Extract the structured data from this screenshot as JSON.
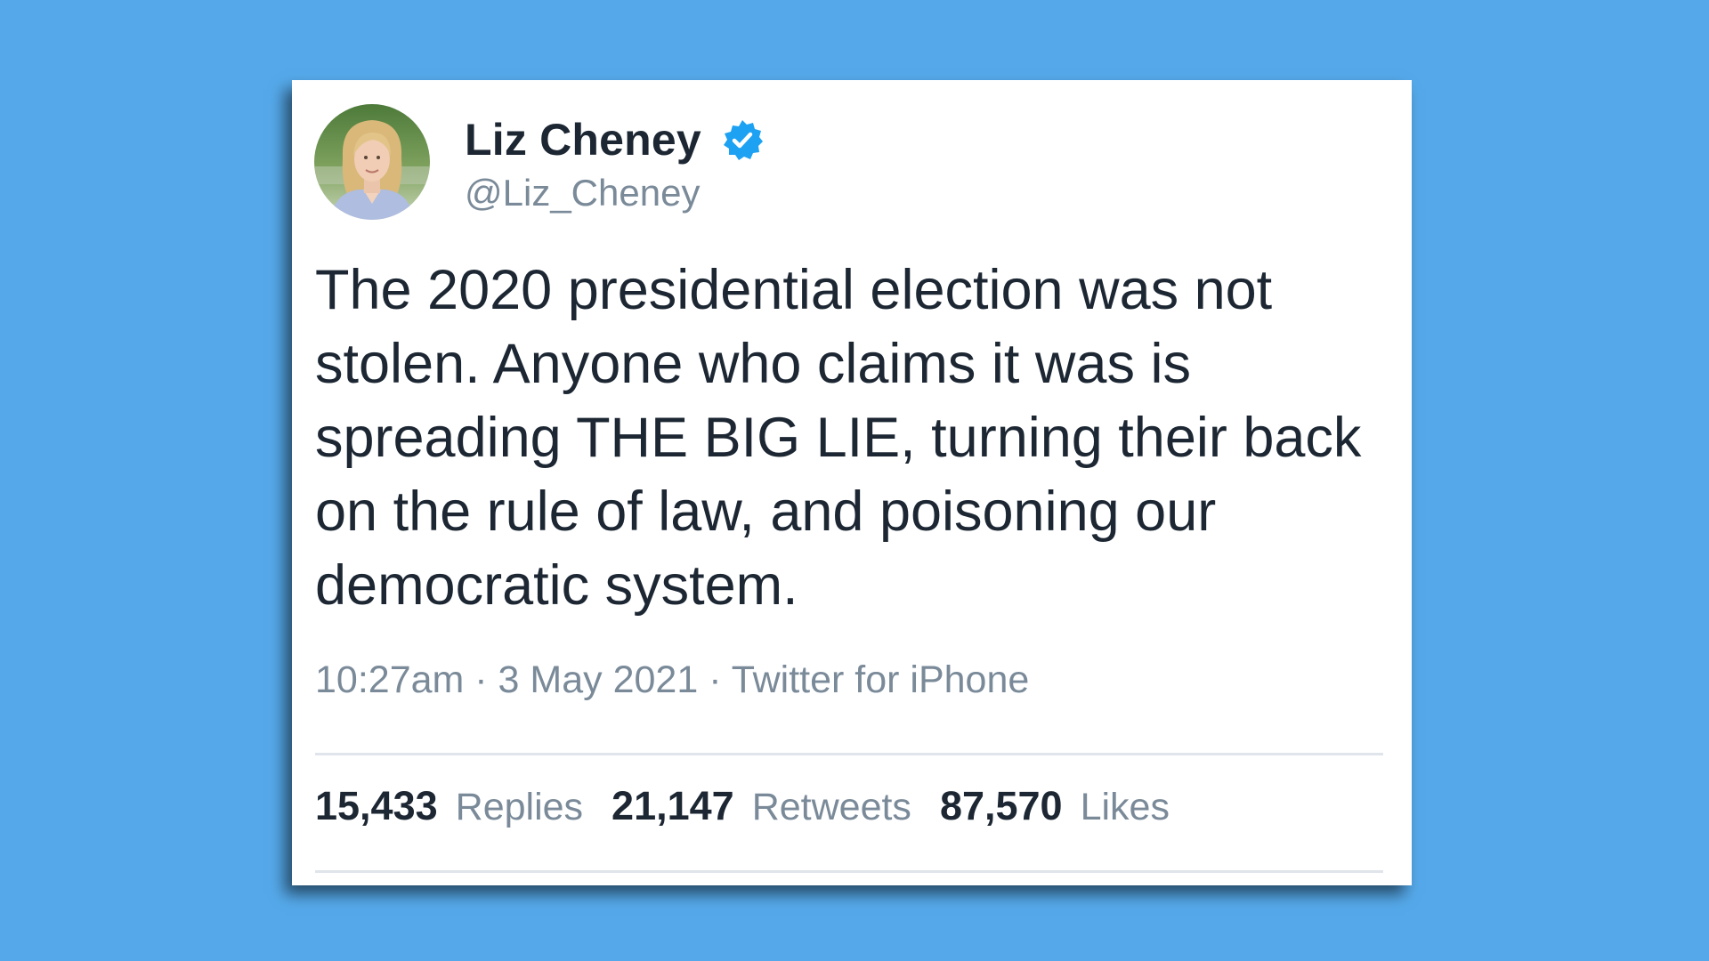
{
  "background_color": "#55a9ea",
  "accent_color": "#1da1f2",
  "tweet": {
    "author": {
      "name": "Liz Cheney",
      "handle": "@Liz_Cheney",
      "verified_icon": "verified-badge-icon",
      "avatar_icon": "profile-photo"
    },
    "text": "The 2020 presidential election was not stolen. Anyone who claims it was is spreading THE BIG LIE, turning their back on the rule of law, and poisoning our democratic system.",
    "meta": "10:27am · 3 May 2021 · Twitter for iPhone",
    "stats": {
      "replies_count": "15,433",
      "replies_label": "Replies",
      "retweets_count": "21,147",
      "retweets_label": "Retweets",
      "likes_count": "87,570",
      "likes_label": "Likes"
    }
  }
}
